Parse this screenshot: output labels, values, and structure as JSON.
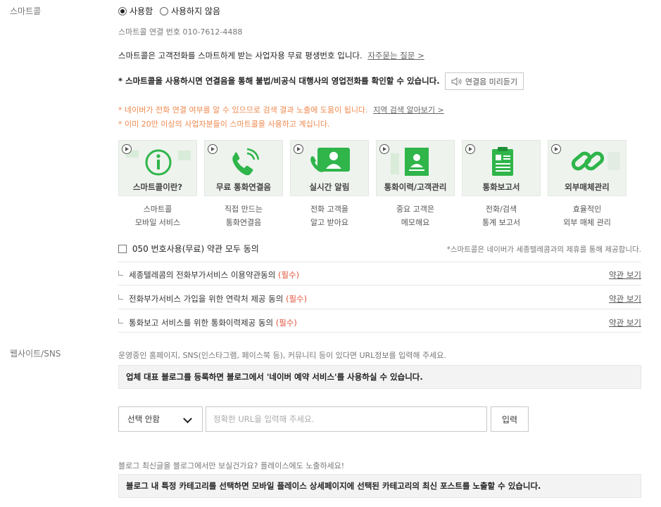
{
  "smartcall": {
    "section_label": "스마트콜",
    "radio_use": "사용함",
    "radio_nouse": "사용하지 않음",
    "number_line": "스마트콜 연결 번호 010-7612-4488",
    "intro": "스마트콜은 고객전화를 스마트하게 받는 사업자용 무료 평생번호 입니다.",
    "faq_link": "자주묻는 질문 >",
    "notice_bold": "* 스마트콜을 사용하시면 연결음을 통해 불법/비공식 대행사의 영업전화를 확인할 수 있습니다.",
    "preview_button": "연결음 미리듣기",
    "orange_line1": "* 네이버가 전화 연결 여부를 알 수 있으므로 검색 결과 노출에 도움이 됩니다.",
    "region_link": "지역 검색 알아보기 >",
    "orange_line2": "* 이미 20만 이상의 사업자분들이 스마트콜을 사용하고 계십니다.",
    "cards": [
      {
        "title": "스마트콜이란?",
        "desc1": "스마트콜",
        "desc2": "모바일 서비스"
      },
      {
        "title": "무료 통화연결음",
        "desc1": "직접 만드는",
        "desc2": "통화연결음"
      },
      {
        "title": "실시간 알림",
        "desc1": "전화 고객을",
        "desc2": "알고 받아요"
      },
      {
        "title": "통화이력/고객관리",
        "desc1": "중요 고객은",
        "desc2": "메모해요"
      },
      {
        "title": "통화보고서",
        "desc1": "전화/검색",
        "desc2": "통계 보고서"
      },
      {
        "title": "외부매체관리",
        "desc1": "효율적인",
        "desc2": "외부 매체 관리"
      }
    ],
    "agree_all": "050 번호사용(무료) 약관 모두 동의",
    "partner_note": "*스마트콜은 네이버가 세종텔레콤과의 제휴를 통해 제공합니다.",
    "agreements": [
      {
        "text": "세종텔레콤의 전화부가서비스 이용약관동의",
        "required": "(필수)",
        "link": "약관 보기"
      },
      {
        "text": "전화부가서비스 가입을 위한 연락처 제공 동의",
        "required": "(필수)",
        "link": "약관 보기"
      },
      {
        "text": "통화보고 서비스를 위한 통화이력제공 동의",
        "required": "(필수)",
        "link": "약관 보기"
      }
    ]
  },
  "website": {
    "section_label": "웹사이트/SNS",
    "desc": "운영중인 홈페이지, SNS(인스타그램, 페이스북 등), 커뮤니티 등이 있다면 URL정보를 입력해 주세요.",
    "blog_box": "업체 대표 블로그를 등록하면 블로그에서 '네이버 예약 서비스'를 사용하실 수 있습니다.",
    "select_value": "선택 안함",
    "url_placeholder": "정확한 URL을 입력해 주세요.",
    "input_button": "입력",
    "blog_question": "블로그 최신글을 블로그에서만 보실건가요? 플레이스에도 노출하세요!",
    "category_box": "블로그 내 특정 카테고리를 선택하면 모바일 플레이스 상세페이지에 선택된 카테고리의 최신 포스트를 노출할 수 있습니다."
  },
  "colors": {
    "green": "#2fb54a",
    "orange": "#ef8a4f",
    "required": "#e0543c"
  }
}
